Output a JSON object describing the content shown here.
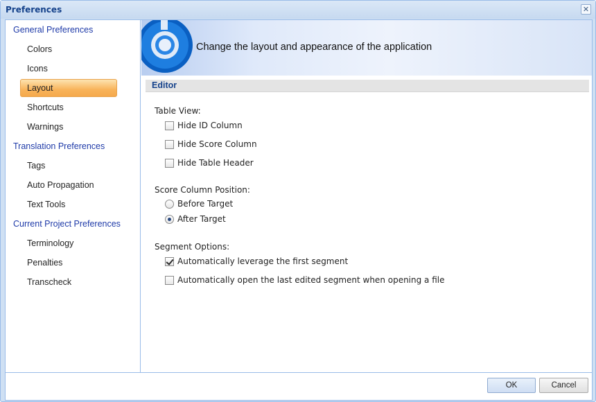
{
  "window": {
    "title": "Preferences",
    "close_icon": "close-icon"
  },
  "sidebar": {
    "groups": [
      {
        "label": "General Preferences",
        "items": [
          "Colors",
          "Icons",
          "Layout",
          "Shortcuts",
          "Warnings"
        ]
      },
      {
        "label": "Translation Preferences",
        "items": [
          "Tags",
          "Auto Propagation",
          "Text Tools"
        ]
      },
      {
        "label": "Current Project Preferences",
        "items": [
          "Terminology",
          "Penalties",
          "Transcheck"
        ]
      }
    ],
    "selected": "Layout"
  },
  "banner": {
    "text": "Change the layout and appearance of the application",
    "logo_icon": "app-logo-icon"
  },
  "section": {
    "title": "Editor"
  },
  "table_view": {
    "label": "Table View:",
    "options": [
      {
        "label": "Hide ID Column",
        "checked": false
      },
      {
        "label": "Hide Score Column",
        "checked": false
      },
      {
        "label": "Hide Table Header",
        "checked": false
      }
    ]
  },
  "score_position": {
    "label": "Score Column Position:",
    "options": [
      {
        "label": "Before Target",
        "selected": false
      },
      {
        "label": "After Target",
        "selected": true
      }
    ]
  },
  "segment_options": {
    "label": "Segment Options:",
    "options": [
      {
        "label": "Automatically leverage the first segment",
        "checked": true
      },
      {
        "label": "Automatically open the last edited segment when opening a file",
        "checked": false
      }
    ]
  },
  "footer": {
    "ok_label": "OK",
    "cancel_label": "Cancel"
  },
  "colors": {
    "accent": "#15428b",
    "selection": "#f8b35a",
    "link": "#1e3aa8"
  }
}
